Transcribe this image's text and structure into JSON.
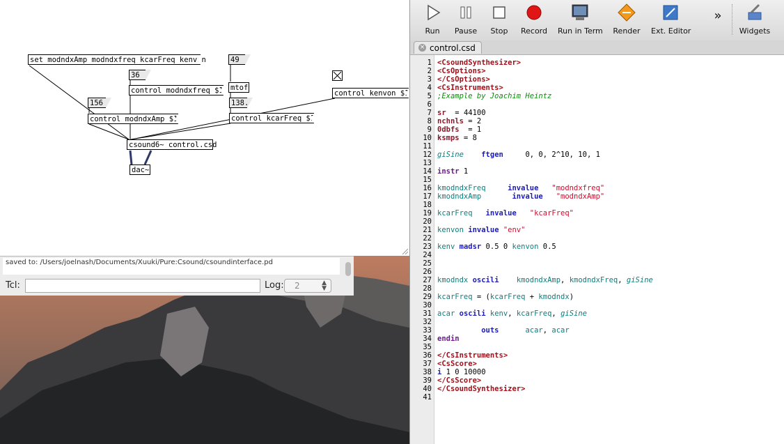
{
  "pd_canvas": {
    "objects": {
      "msg_set": "set modndxAmp modndxfreq kcarFreq kenvon",
      "num_49": "49",
      "num_36": "36",
      "obj_ctrl_freq": "control modndxfreq $1",
      "obj_mtof": "mtof",
      "num_156": "156",
      "num_1385": "138.5",
      "obj_ctrl_amp": "control modndxAmp $1",
      "obj_ctrl_carfreq": "control kcarFreq $1",
      "obj_ctrl_kenvon": "control kenvon $1",
      "obj_csound": "csound6~ control.csd",
      "obj_dac": "dac~"
    }
  },
  "pd_console": {
    "log_text": "saved to: /Users/joelnash/Documents/Xuuki/Pure:Csound/csoundinterface.pd",
    "tcl_label": "Tcl:",
    "tcl_value": "",
    "log_label": "Log:",
    "log_value": "2"
  },
  "csoundqt": {
    "toolbar": {
      "run": "Run",
      "pause": "Pause",
      "stop": "Stop",
      "record": "Record",
      "run_in_term": "Run in Term",
      "render": "Render",
      "ext_editor": "Ext. Editor",
      "more": "»",
      "widgets": "Widgets"
    },
    "tab": {
      "label": "control.csd",
      "close": "×"
    },
    "lines": [
      {
        "n": "1",
        "t": [
          [
            "tag",
            "<CsoundSynthesizer>"
          ]
        ]
      },
      {
        "n": "2",
        "t": [
          [
            "tag",
            "<CsOptions>"
          ]
        ]
      },
      {
        "n": "3",
        "t": [
          [
            "tag",
            "</CsOptions>"
          ]
        ]
      },
      {
        "n": "4",
        "t": [
          [
            "tag",
            "<CsInstruments>"
          ]
        ]
      },
      {
        "n": "5",
        "t": [
          [
            "cmt",
            ";Example by Joachim Heintz"
          ]
        ]
      },
      {
        "n": "6",
        "t": []
      },
      {
        "n": "7",
        "t": [
          [
            "hdr",
            "sr"
          ],
          [
            "",
            "  = 44100"
          ]
        ]
      },
      {
        "n": "8",
        "t": [
          [
            "hdr",
            "nchnls"
          ],
          [
            "",
            " = 2"
          ]
        ]
      },
      {
        "n": "9",
        "t": [
          [
            "hdr",
            "0dbfs"
          ],
          [
            "",
            "  = 1"
          ]
        ]
      },
      {
        "n": "10",
        "t": [
          [
            "hdr",
            "ksmps"
          ],
          [
            "",
            " = 8"
          ]
        ]
      },
      {
        "n": "11",
        "t": []
      },
      {
        "n": "12",
        "t": [
          [
            "gvar",
            "giSine"
          ],
          [
            "",
            "    "
          ],
          [
            "kw",
            "ftgen"
          ],
          [
            "",
            "     0, 0, 2^10, 10, 1"
          ]
        ]
      },
      {
        "n": "13",
        "t": []
      },
      {
        "n": "14",
        "t": [
          [
            "instr",
            "instr"
          ],
          [
            "",
            " 1"
          ]
        ]
      },
      {
        "n": "15",
        "t": []
      },
      {
        "n": "16",
        "t": [
          [
            "var",
            "kmodndxFreq"
          ],
          [
            "",
            "     "
          ],
          [
            "kw",
            "invalue"
          ],
          [
            "",
            "   "
          ],
          [
            "str",
            "\"modndxfreq\""
          ]
        ]
      },
      {
        "n": "17",
        "t": [
          [
            "var",
            "kmodndxAmp"
          ],
          [
            "",
            "       "
          ],
          [
            "kw",
            "invalue"
          ],
          [
            "",
            "   "
          ],
          [
            "str",
            "\"modndxAmp\""
          ]
        ]
      },
      {
        "n": "18",
        "t": []
      },
      {
        "n": "19",
        "t": [
          [
            "var",
            "kcarFreq"
          ],
          [
            "",
            "   "
          ],
          [
            "kw",
            "invalue"
          ],
          [
            "",
            "   "
          ],
          [
            "str",
            "\"kcarFreq\""
          ]
        ]
      },
      {
        "n": "20",
        "t": []
      },
      {
        "n": "21",
        "t": [
          [
            "var",
            "kenvon"
          ],
          [
            "",
            " "
          ],
          [
            "kw",
            "invalue"
          ],
          [
            "",
            " "
          ],
          [
            "str",
            "\"env\""
          ]
        ]
      },
      {
        "n": "22",
        "t": []
      },
      {
        "n": "23",
        "t": [
          [
            "var",
            "kenv"
          ],
          [
            "",
            " "
          ],
          [
            "kw",
            "madsr"
          ],
          [
            "",
            " 0.5 0 "
          ],
          [
            "var",
            "kenvon"
          ],
          [
            "",
            " 0.5"
          ]
        ]
      },
      {
        "n": "24",
        "t": []
      },
      {
        "n": "25",
        "t": []
      },
      {
        "n": "26",
        "t": []
      },
      {
        "n": "27",
        "t": [
          [
            "var",
            "kmodndx"
          ],
          [
            "",
            " "
          ],
          [
            "kw",
            "oscili"
          ],
          [
            "",
            "    "
          ],
          [
            "var",
            "kmodndxAmp"
          ],
          [
            "",
            ", "
          ],
          [
            "var",
            "kmodndxFreq"
          ],
          [
            "",
            ", "
          ],
          [
            "gvar",
            "giSine"
          ]
        ]
      },
      {
        "n": "28",
        "t": []
      },
      {
        "n": "29",
        "t": [
          [
            "var",
            "kcarFreq"
          ],
          [
            "",
            " = ("
          ],
          [
            "var",
            "kcarFreq"
          ],
          [
            "",
            " + "
          ],
          [
            "var",
            "kmodndx"
          ],
          [
            "",
            ")"
          ]
        ]
      },
      {
        "n": "30",
        "t": []
      },
      {
        "n": "31",
        "t": [
          [
            "var",
            "acar"
          ],
          [
            "",
            " "
          ],
          [
            "kw",
            "oscili"
          ],
          [
            "",
            " "
          ],
          [
            "var",
            "kenv"
          ],
          [
            "",
            ", "
          ],
          [
            "var",
            "kcarFreq"
          ],
          [
            "",
            ", "
          ],
          [
            "gvar",
            "giSine"
          ]
        ]
      },
      {
        "n": "32",
        "t": []
      },
      {
        "n": "33",
        "t": [
          [
            "",
            "          "
          ],
          [
            "kw",
            "outs"
          ],
          [
            "",
            "      "
          ],
          [
            "var",
            "acar"
          ],
          [
            "",
            ", "
          ],
          [
            "var",
            "acar"
          ]
        ]
      },
      {
        "n": "34",
        "t": [
          [
            "instr",
            "endin"
          ]
        ]
      },
      {
        "n": "35",
        "t": []
      },
      {
        "n": "36",
        "t": [
          [
            "tag",
            "</CsInstruments>"
          ]
        ]
      },
      {
        "n": "37",
        "t": [
          [
            "tag",
            "<CsScore>"
          ]
        ]
      },
      {
        "n": "38",
        "t": [
          [
            "kw",
            "i"
          ],
          [
            "",
            " 1 0 10000"
          ]
        ]
      },
      {
        "n": "39",
        "t": [
          [
            "tag",
            "</CsScore>"
          ]
        ]
      },
      {
        "n": "40",
        "t": [
          [
            "tag",
            "</CsoundSynthesizer>"
          ]
        ]
      },
      {
        "n": "41",
        "t": []
      }
    ]
  }
}
